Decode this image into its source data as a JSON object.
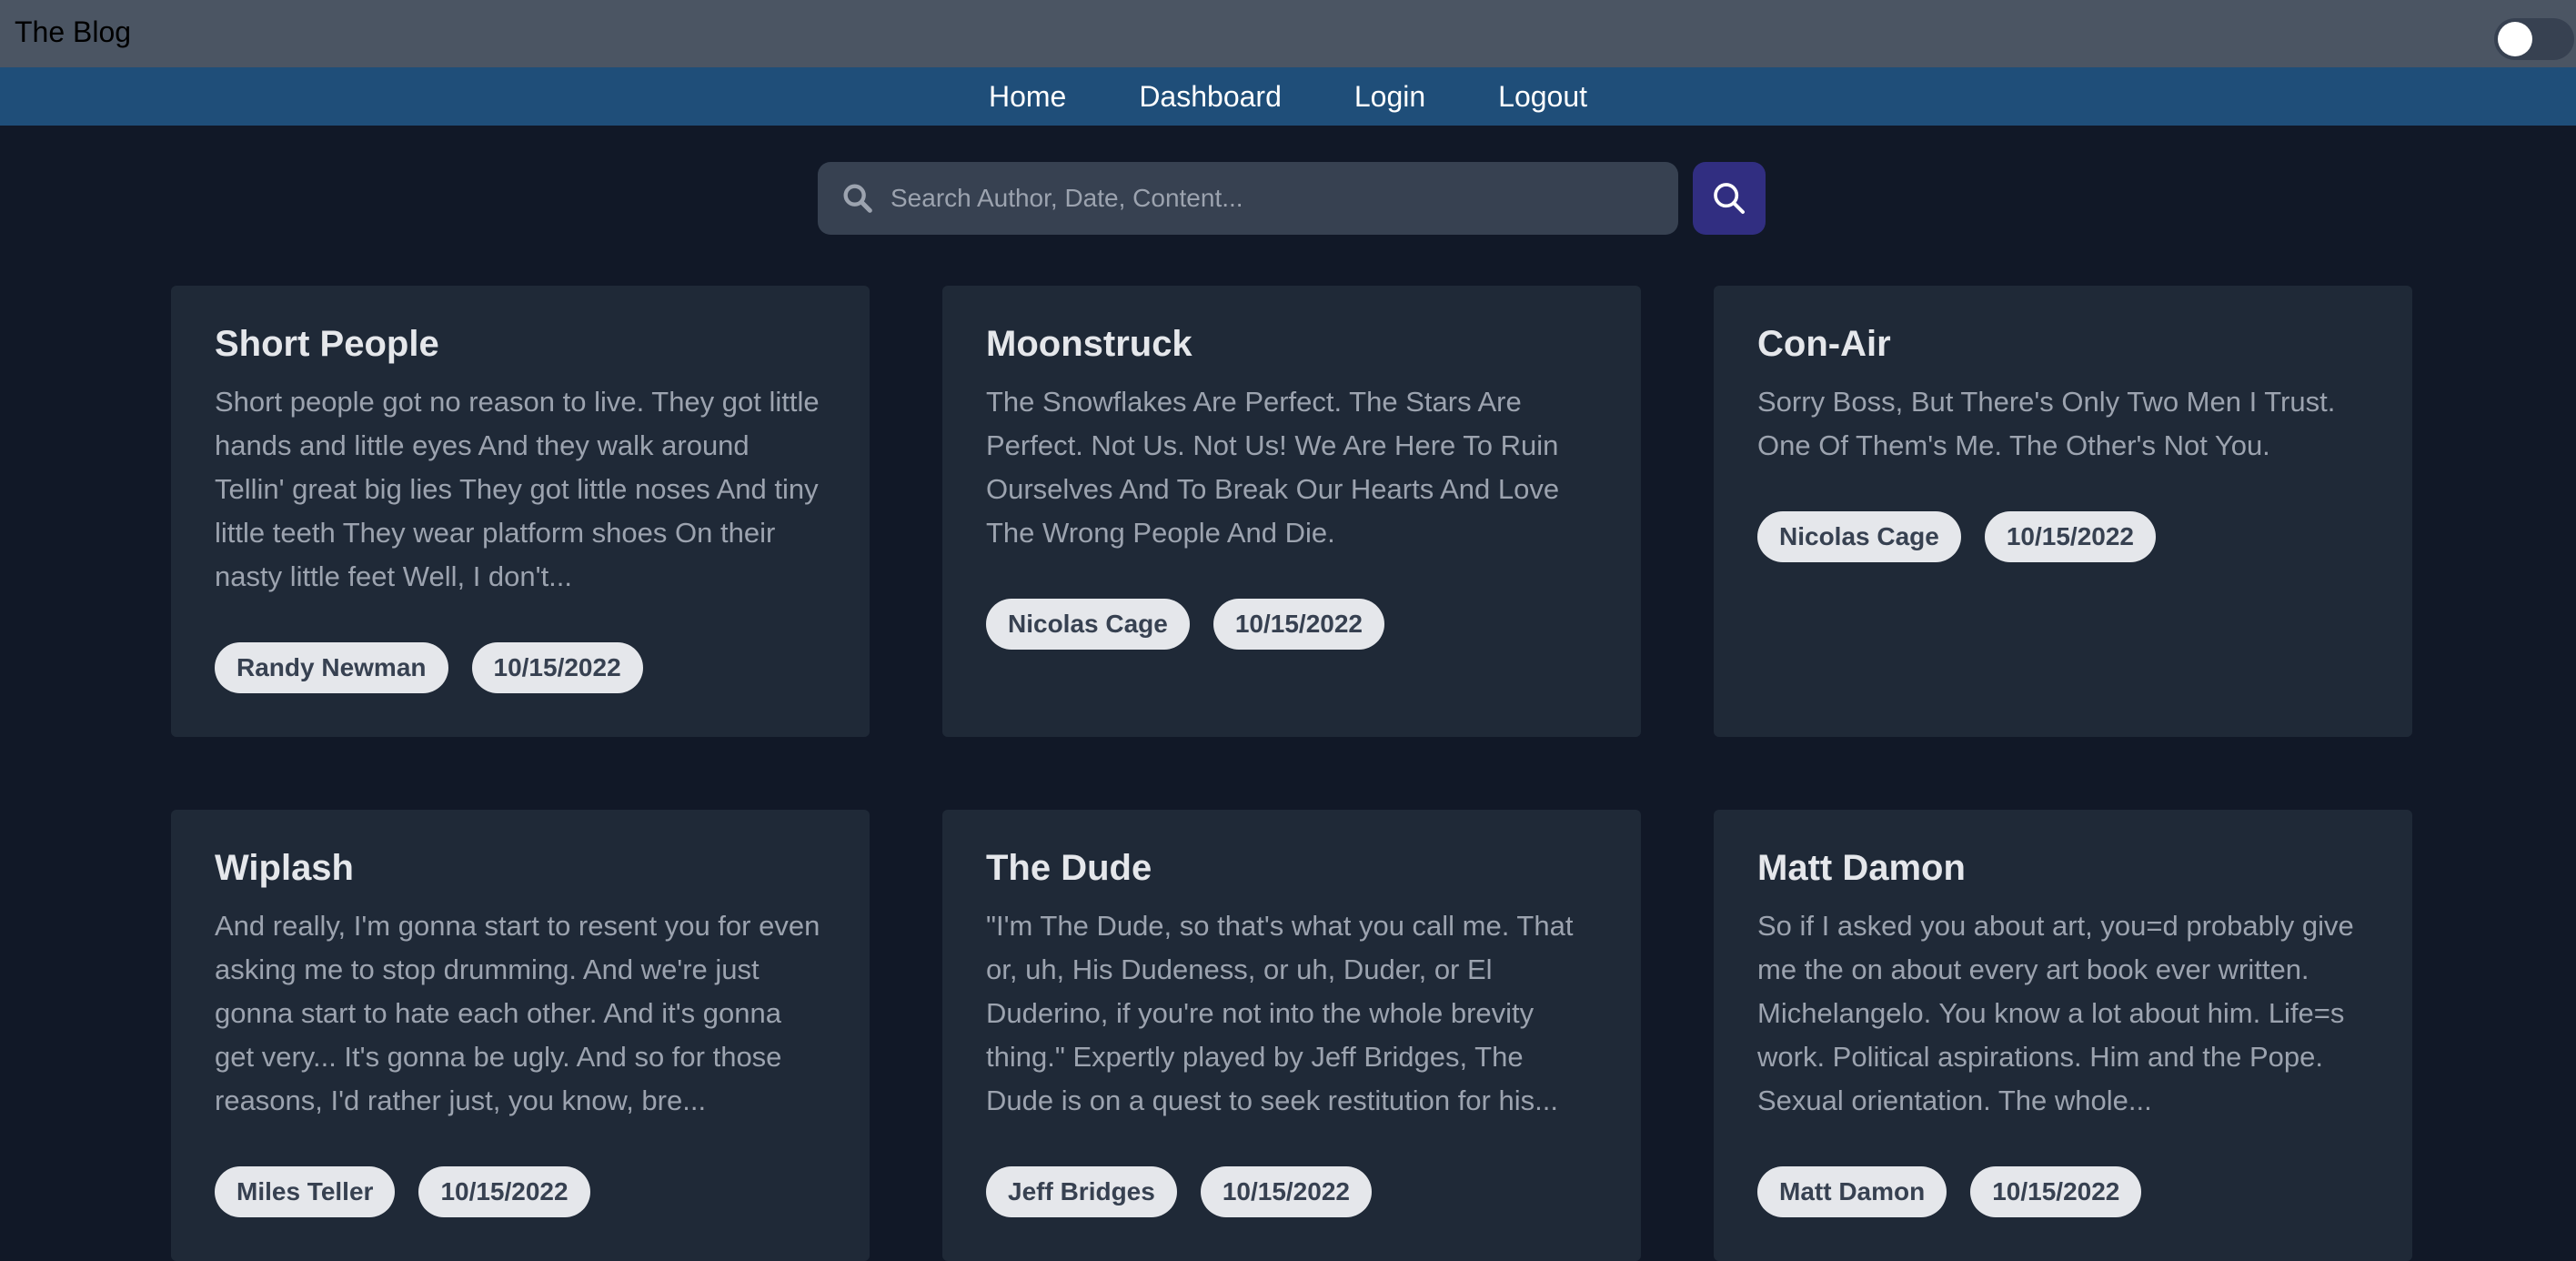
{
  "header": {
    "brand": "The Blog",
    "theme_toggle": "off"
  },
  "nav": {
    "items": [
      {
        "label": "Home"
      },
      {
        "label": "Dashboard"
      },
      {
        "label": "Login"
      },
      {
        "label": "Logout"
      }
    ]
  },
  "search": {
    "placeholder": "Search Author, Date, Content...",
    "value": ""
  },
  "posts": [
    {
      "title": "Short People",
      "body": "Short people got no reason to live. They got little hands and little eyes And they walk around Tellin' great big lies They got little noses And tiny little teeth They wear platform shoes On their nasty little feet Well, I don't...",
      "author": "Randy Newman",
      "date": "10/15/2022"
    },
    {
      "title": "Moonstruck",
      "body": "The Snowflakes Are Perfect. The Stars Are Perfect. Not Us. Not Us! We Are Here To Ruin Ourselves And To Break Our Hearts And Love The Wrong People And Die.",
      "author": "Nicolas Cage",
      "date": "10/15/2022"
    },
    {
      "title": "Con-Air",
      "body": "Sorry Boss, But There's Only Two Men I Trust. One Of Them's Me. The Other's Not You.",
      "author": "Nicolas Cage",
      "date": "10/15/2022"
    },
    {
      "title": "Wiplash",
      "body": "And really, I'm gonna start to resent you for even asking me to stop drumming. And we're just gonna start to hate each other. And it's gonna get very... It's gonna be ugly. And so for those reasons, I'd rather just, you know, bre...",
      "author": "Miles Teller",
      "date": "10/15/2022"
    },
    {
      "title": "The Dude",
      "body": "\"I'm The Dude, so that's what you call me. That or, uh, His Dudeness, or uh, Duder, or El Duderino, if you're not into the whole brevity thing.\" Expertly played by Jeff Bridges, The Dude is on a quest to seek restitution for his...",
      "author": "Jeff Bridges",
      "date": "10/15/2022"
    },
    {
      "title": "Matt Damon",
      "body": "So if I asked you about art, you=d probably give me the on about every art book ever written. Michelangelo. You know a lot about him. Life=s work. Political aspirations. Him and the Pope. Sexual orientation. The whole...",
      "author": "Matt Damon",
      "date": "10/15/2022"
    }
  ]
}
